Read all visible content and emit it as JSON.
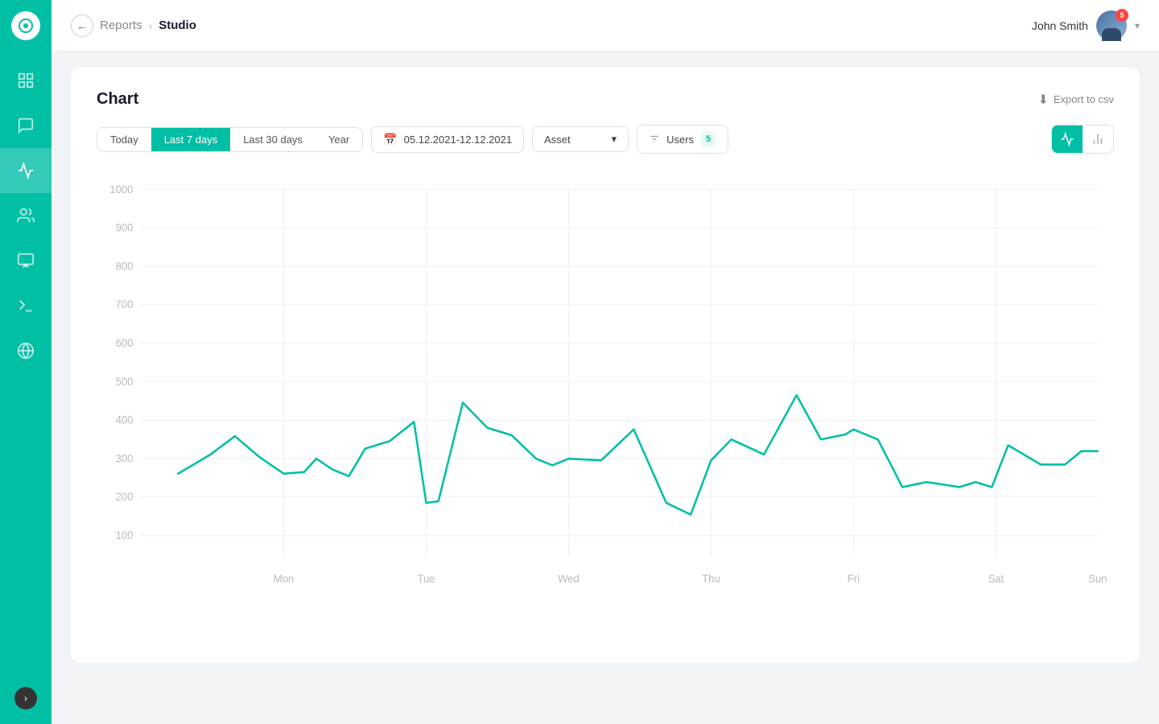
{
  "sidebar": {
    "items": [
      {
        "name": "grid-icon",
        "label": "Dashboard",
        "active": false
      },
      {
        "name": "chat-icon",
        "label": "Messages",
        "active": false
      },
      {
        "name": "chart-icon",
        "label": "Reports",
        "active": true
      },
      {
        "name": "users-icon",
        "label": "Users",
        "active": false
      },
      {
        "name": "presentation-icon",
        "label": "Presentations",
        "active": false
      },
      {
        "name": "tools-icon",
        "label": "Tools",
        "active": false
      },
      {
        "name": "globe-icon",
        "label": "Global",
        "active": false
      }
    ],
    "collapse_label": ">"
  },
  "topbar": {
    "back_label": "‹",
    "breadcrumb_parent": "Reports",
    "breadcrumb_sep": "›",
    "breadcrumb_current": "Studio",
    "user_name": "John Smith",
    "notification_count": "5",
    "dropdown_arrow": "▾"
  },
  "card": {
    "title": "Chart",
    "export_label": "Export to csv",
    "filters": {
      "period_options": [
        "Today",
        "Last 7 days",
        "Last 30 days",
        "Year"
      ],
      "active_period": "Last 7 days",
      "date_range": "05.12.2021-12.12.2021",
      "asset_label": "Asset",
      "users_label": "Users",
      "users_count": "5"
    },
    "chart": {
      "y_labels": [
        "100",
        "200",
        "300",
        "400",
        "500",
        "600",
        "700",
        "800",
        "900",
        "1000"
      ],
      "x_labels": [
        "Mon",
        "Tue",
        "Wed",
        "Thu",
        "Fri",
        "Sat",
        "Sun"
      ],
      "line_color": "#00bfa5"
    }
  }
}
